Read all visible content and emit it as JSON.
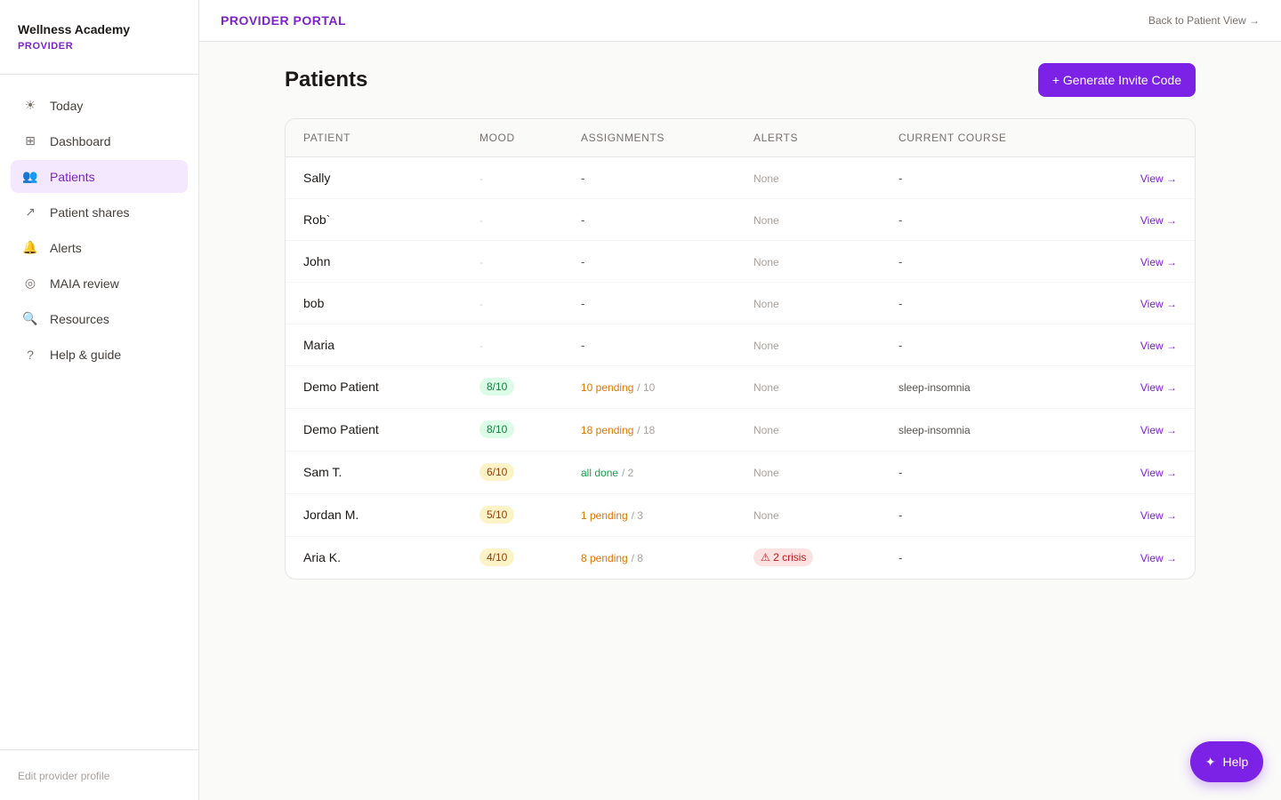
{
  "brand": {
    "name": "Wellness Academy",
    "role": "PROVIDER"
  },
  "sidebar": {
    "items": [
      {
        "label": "Today",
        "icon": "☀"
      },
      {
        "label": "Dashboard",
        "icon": "⊞"
      },
      {
        "label": "Patients",
        "icon": "👥"
      },
      {
        "label": "Patient shares",
        "icon": "↗"
      },
      {
        "label": "Alerts",
        "icon": "🔔"
      },
      {
        "label": "MAIA review",
        "icon": "◎"
      },
      {
        "label": "Resources",
        "icon": "🔍"
      },
      {
        "label": "Help & guide",
        "icon": "?"
      }
    ],
    "active_index": 2,
    "footer": "Edit provider profile"
  },
  "topbar": {
    "portal_label": "PROVIDER PORTAL",
    "back_link": "Back to Patient View →"
  },
  "page": {
    "title": "Patients",
    "invite_button": "+ Generate Invite Code"
  },
  "table": {
    "columns": [
      "PATIENT",
      "MOOD",
      "ASSIGNMENTS",
      "ALERTS",
      "CURRENT COURSE"
    ],
    "rows": [
      {
        "name": "Sally",
        "mood": "-",
        "assign_main": "-",
        "assign_total": "",
        "alerts": "None",
        "course": "-",
        "view": "View →"
      },
      {
        "name": "Rob`",
        "mood": "-",
        "assign_main": "-",
        "assign_total": "",
        "alerts": "None",
        "course": "-",
        "view": "View →"
      },
      {
        "name": "John",
        "mood": "-",
        "assign_main": "-",
        "assign_total": "",
        "alerts": "None",
        "course": "-",
        "view": "View →"
      },
      {
        "name": "bob",
        "mood": "-",
        "assign_main": "-",
        "assign_total": "",
        "alerts": "None",
        "course": "-",
        "view": "View →"
      },
      {
        "name": "Maria",
        "mood": "-",
        "assign_main": "-",
        "assign_total": "",
        "alerts": "None",
        "course": "-",
        "view": "View →"
      },
      {
        "name": "Demo Patient",
        "mood": "8/10",
        "assign_main": "10 pending",
        "assign_total": "/ 10",
        "alerts": "None",
        "course": "sleep-insomnia",
        "view": "View →"
      },
      {
        "name": "Demo Patient",
        "mood": "8/10",
        "assign_main": "18 pending",
        "assign_total": "/ 18",
        "alerts": "None",
        "course": "sleep-insomnia",
        "view": "View →"
      },
      {
        "name": "Sam T.",
        "mood": "6/10",
        "assign_main": "all done",
        "assign_total": "/ 2",
        "alerts": "None",
        "course": "-",
        "view": "View →"
      },
      {
        "name": "Jordan M.",
        "mood": "5/10",
        "assign_main": "1 pending",
        "assign_total": "/ 3",
        "alerts": "None",
        "course": "-",
        "view": "View →"
      },
      {
        "name": "Aria K.",
        "mood": "4/10",
        "assign_main": "8 pending",
        "assign_total": "/ 8",
        "alerts": "⚠ 2 crisis",
        "course": "-",
        "view": "View →"
      }
    ]
  },
  "help_fab": {
    "icon": "✦",
    "label": "Help"
  }
}
